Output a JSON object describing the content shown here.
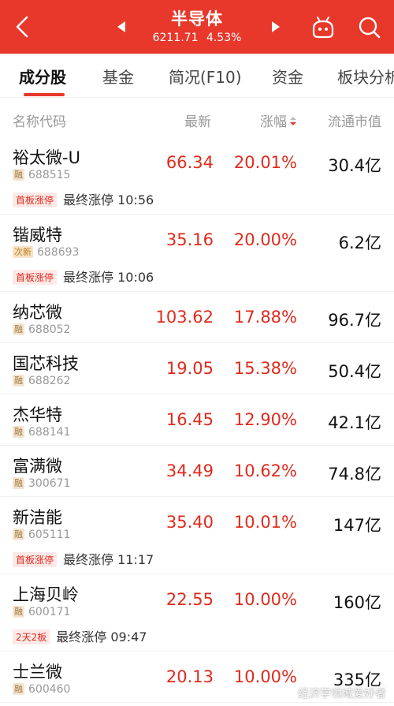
{
  "header": {
    "title": "半导体",
    "index_value": "6211.71",
    "index_change": "4.53%"
  },
  "tabs": [
    {
      "label": "成分股"
    },
    {
      "label": "基金"
    },
    {
      "label": "简况(F10)"
    },
    {
      "label": "资金"
    },
    {
      "label": "板块分析"
    }
  ],
  "columns": {
    "name": "名称代码",
    "latest": "最新",
    "change": "涨幅",
    "market_cap": "流通市值"
  },
  "stocks": [
    {
      "name": "裕太微-U",
      "tag": "融",
      "code": "688515",
      "price": "66.34",
      "change": "20.01%",
      "cap": "30.4亿",
      "status_tag": "首板涨停",
      "status_text": "最终涨停 10:56"
    },
    {
      "name": "锴威特",
      "tag": "次新",
      "code": "688693",
      "price": "35.16",
      "change": "20.00%",
      "cap": "6.2亿",
      "status_tag": "首板涨停",
      "status_text": "最终涨停 10:06"
    },
    {
      "name": "纳芯微",
      "tag": "融",
      "code": "688052",
      "price": "103.62",
      "change": "17.88%",
      "cap": "96.7亿"
    },
    {
      "name": "国芯科技",
      "tag": "融",
      "code": "688262",
      "price": "19.05",
      "change": "15.38%",
      "cap": "50.4亿"
    },
    {
      "name": "杰华特",
      "tag": "融",
      "code": "688141",
      "price": "16.45",
      "change": "12.90%",
      "cap": "42.1亿"
    },
    {
      "name": "富满微",
      "tag": "融",
      "code": "300671",
      "price": "34.49",
      "change": "10.62%",
      "cap": "74.8亿"
    },
    {
      "name": "新洁能",
      "tag": "融",
      "code": "605111",
      "price": "35.40",
      "change": "10.01%",
      "cap": "147亿",
      "status_tag": "首板涨停",
      "status_text": "最终涨停 11:17"
    },
    {
      "name": "上海贝岭",
      "tag": "融",
      "code": "600171",
      "price": "22.55",
      "change": "10.00%",
      "cap": "160亿",
      "status_tag": "2天2板",
      "status_text": "最终涨停 09:47"
    },
    {
      "name": "士兰微",
      "tag": "融",
      "code": "600460",
      "price": "20.13",
      "change": "10.00%",
      "cap": "335亿"
    }
  ],
  "watermark": "经济学领域爱好者",
  "colors": {
    "brand": "#e7382b",
    "up": "#e12a1c"
  }
}
